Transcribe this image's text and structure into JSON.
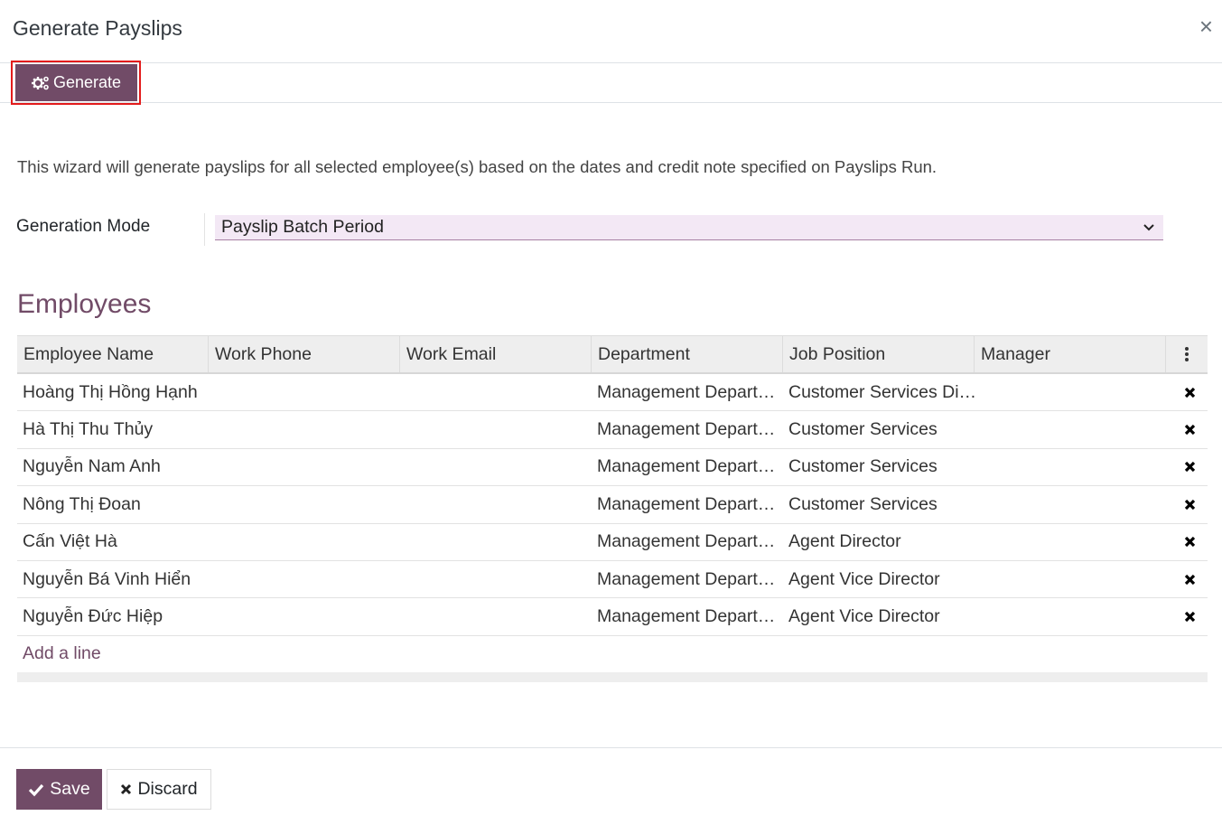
{
  "modal": {
    "title": "Generate Payslips",
    "close_glyph": "×"
  },
  "toolbar": {
    "generate_label": "Generate",
    "generate_icon": "gears-icon"
  },
  "form": {
    "description": "This wizard will generate payslips for all selected employee(s) based on the dates and credit note specified on Payslips Run.",
    "generation_mode_label": "Generation Mode",
    "generation_mode_value": "Payslip Batch Period"
  },
  "employees": {
    "section_title": "Employees",
    "columns": [
      "Employee Name",
      "Work Phone",
      "Work Email",
      "Department",
      "Job Position",
      "Manager"
    ],
    "rows": [
      {
        "name": "Hoàng Thị Hồng Hạnh",
        "phone": "",
        "email": "",
        "department": "Management Depart…",
        "job": "Customer Services Di…",
        "manager": ""
      },
      {
        "name": "Hà Thị Thu Thủy",
        "phone": "",
        "email": "",
        "department": "Management Depart…",
        "job": "Customer Services",
        "manager": ""
      },
      {
        "name": "Nguyễn Nam Anh",
        "phone": "",
        "email": "",
        "department": "Management Depart…",
        "job": "Customer Services",
        "manager": ""
      },
      {
        "name": "Nông Thị Đoan",
        "phone": "",
        "email": "",
        "department": "Management Depart…",
        "job": "Customer Services",
        "manager": ""
      },
      {
        "name": "Cấn Việt Hà",
        "phone": "",
        "email": "",
        "department": "Management Depart…",
        "job": "Agent Director",
        "manager": ""
      },
      {
        "name": "Nguyễn Bá Vinh Hiển",
        "phone": "",
        "email": "",
        "department": "Management Depart…",
        "job": "Agent Vice Director",
        "manager": ""
      },
      {
        "name": "Nguyễn Đức Hiệp",
        "phone": "",
        "email": "",
        "department": "Management Depart…",
        "job": "Agent Vice Director",
        "manager": ""
      }
    ],
    "add_line_label": "Add a line"
  },
  "footer": {
    "save_label": "Save",
    "discard_label": "Discard"
  },
  "colors": {
    "brand": "#714b67",
    "highlight": "#e31b1b",
    "select_bg": "#f3e8f5"
  }
}
